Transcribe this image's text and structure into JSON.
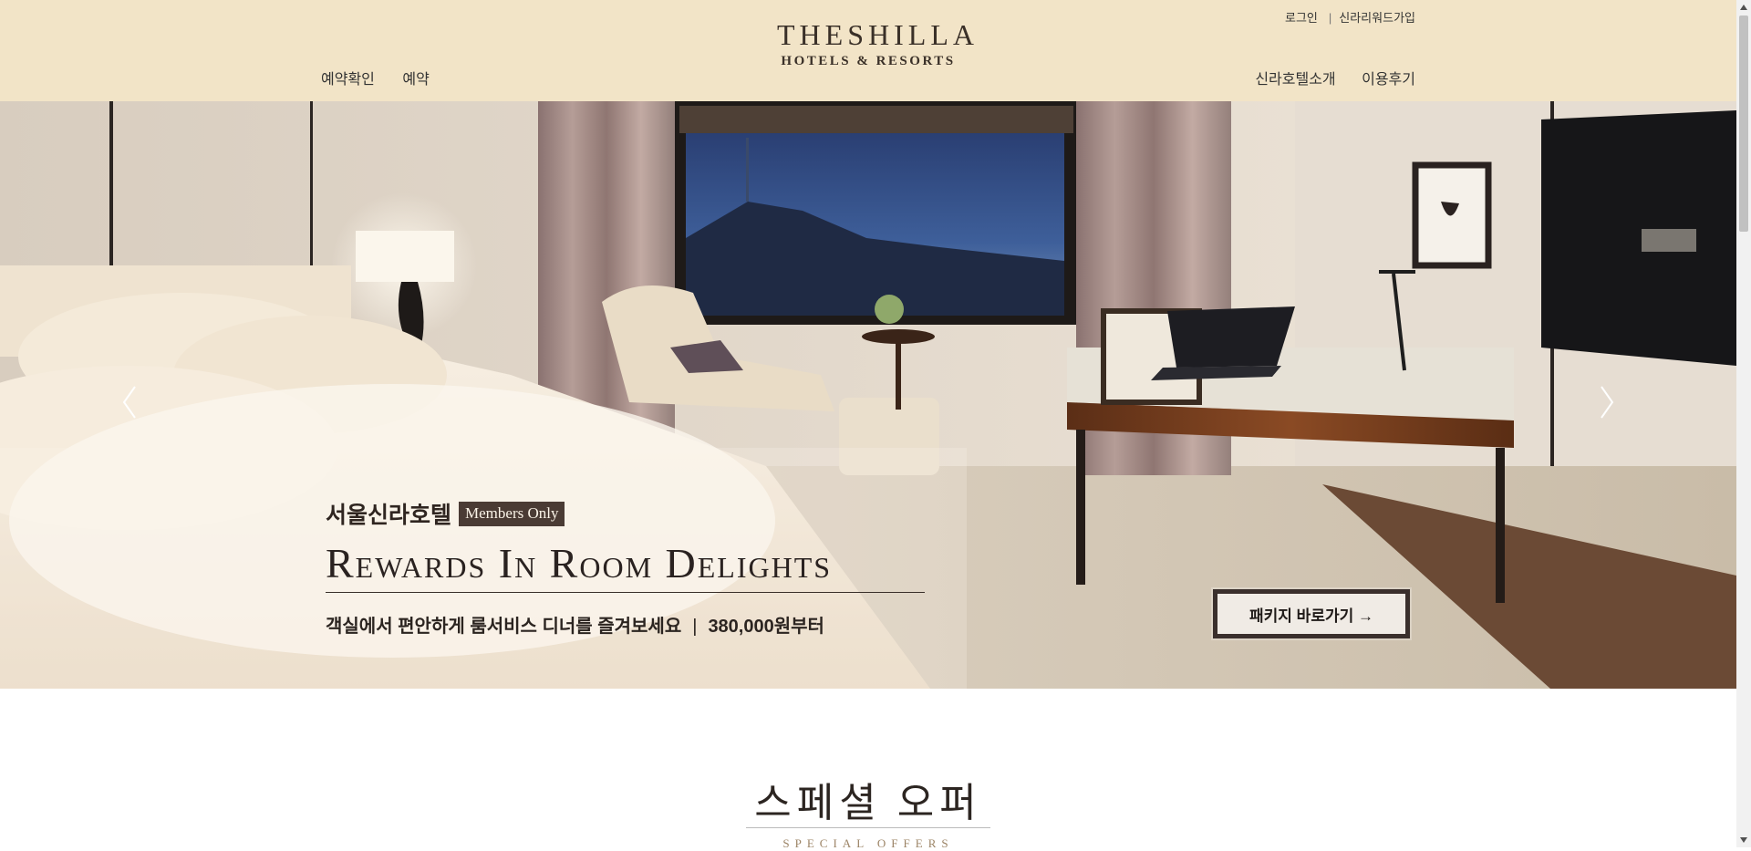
{
  "header": {
    "logo": {
      "main": "THESHILLA",
      "sub": "HOTELS & RESORTS"
    },
    "util": {
      "login": "로그인",
      "separator": "|",
      "signup": "신라리워드가입"
    },
    "nav_left": [
      "예약확인",
      "예약"
    ],
    "nav_right": [
      "신라호텔소개",
      "이용후기"
    ]
  },
  "hero": {
    "hotel": "서울신라호텔",
    "badge": "Members Only",
    "headline": "Rewards In Room Delights",
    "subtitle": "객실에서 편안하게 룸서비스 디너를 즐겨보세요",
    "divider": "|",
    "price": "380,000원부터",
    "cta": "패키지 바로가기 →",
    "icons": {
      "prev": "chevron-left-icon",
      "next": "chevron-right-icon"
    }
  },
  "offers": {
    "title": "스페셜 오퍼",
    "subtitle": "SPECIAL OFFERS"
  },
  "colors": {
    "header_bg": "#f2e4c7",
    "badge_bg": "#4a3b34",
    "offers_subtitle": "#9c8466"
  }
}
